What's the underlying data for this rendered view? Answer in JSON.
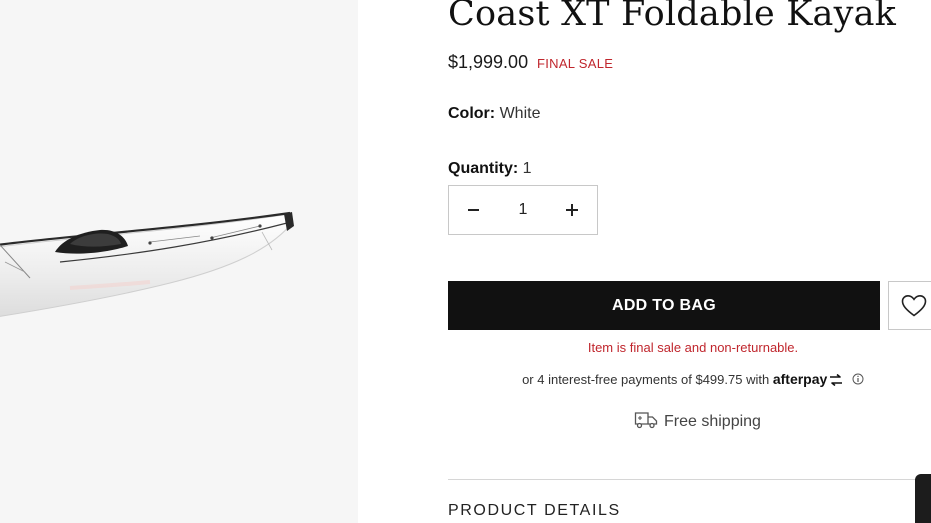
{
  "product": {
    "title": "Coast XT Foldable Kayak",
    "price": "$1,999.00",
    "sale_badge": "FINAL SALE",
    "color_label": "Color:",
    "color_value": "White",
    "quantity_label": "Quantity:",
    "quantity_value": "1",
    "stepper_value": "1"
  },
  "actions": {
    "add_to_bag_label": "ADD TO BAG",
    "wishlist_icon": "heart-icon"
  },
  "notices": {
    "final_sale_note": "Item is final sale and non-returnable.",
    "afterpay_text": "or 4 interest-free payments of $499.75 with",
    "afterpay_brand": "afterpay",
    "shipping_text": "Free shipping"
  },
  "sections": {
    "product_details_heading": "PRODUCT DETAILS"
  },
  "colors": {
    "sale_red": "#c0262d",
    "button_black": "#111111",
    "image_bg": "#f6f6f6"
  }
}
